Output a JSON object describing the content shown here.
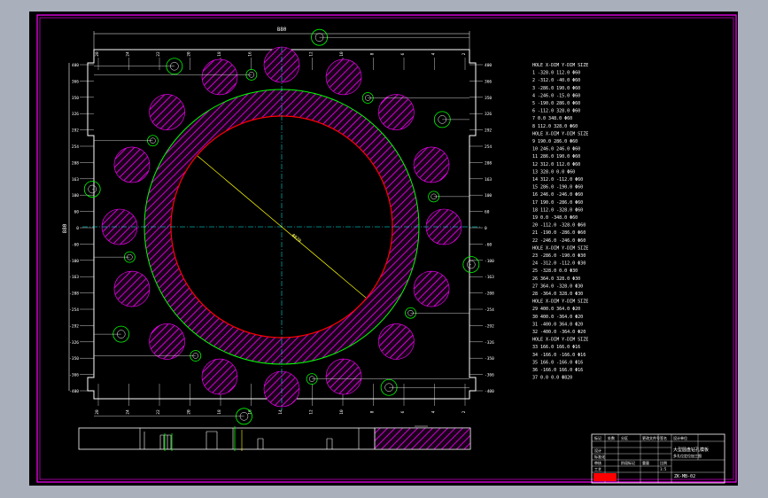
{
  "drawing": {
    "overall_dimension_top": "880",
    "overall_dimension_left": "880",
    "bore_diameter_label": "Φ820",
    "hole_labels_top": [
      "28",
      "24",
      "22",
      "20",
      "18",
      "16",
      "14",
      "12",
      "10",
      "8",
      "6",
      "4",
      "2"
    ],
    "hole_labels_bottom": [
      "28",
      "24",
      "22",
      "20",
      "18",
      "16",
      "14",
      "12",
      "10",
      "8",
      "6",
      "4",
      "2"
    ],
    "dimension_labels_left": [
      "400",
      "366",
      "350",
      "326",
      "292",
      "254",
      "208",
      "163",
      "100",
      "60",
      "0",
      "-60",
      "-100",
      "-163",
      "-208",
      "-254",
      "-292",
      "-326",
      "-350",
      "-366",
      "-400"
    ],
    "dimension_labels_right": [
      "400",
      "366",
      "350",
      "326",
      "292",
      "254",
      "208",
      "163",
      "100",
      "60",
      "0",
      "-60",
      "-100",
      "-163",
      "-208",
      "-254",
      "-292",
      "-326",
      "-350",
      "-366",
      "-400"
    ]
  },
  "hole_table": {
    "rows": [
      "HOLE  X-DIM  Y-DIM  SIZE",
      "1   -328.0   112.0  Φ60",
      "2   -312.0   -40.0  Φ60",
      "3   -286.0   190.0  Φ60",
      "4   -246.0   -15.0  Φ60",
      "5   -190.0   286.0  Φ60",
      "6   -112.0   328.0  Φ60",
      "7      0.0   348.0  Φ60",
      "8    112.0   328.0  Φ60",
      "HOLE  X-DIM  Y-DIM  SIZE",
      "9    190.0   286.0  Φ60",
      "10   246.0   246.0  Φ60",
      "11   286.0   190.0  Φ60",
      "12   312.0   112.0  Φ60",
      "13   328.0     0.0  Φ60",
      "14   312.0  -112.0  Φ60",
      "15   286.0  -190.0  Φ60",
      "16   246.0  -246.0  Φ60",
      "17   190.0  -286.0  Φ60",
      "18   112.0  -328.0  Φ60",
      "19     0.0  -348.0  Φ60",
      "20  -112.0  -328.0  Φ60",
      "21  -190.0  -286.0  Φ60",
      "22  -246.0  -246.0  Φ60",
      "HOLE  X-DIM  Y-DIM  SIZE",
      "23  -286.0  -190.0  Φ30",
      "24  -312.0  -112.0  Φ30",
      "25  -328.0     0.0  Φ30",
      "26   364.0   328.0  Φ30",
      "27   364.0  -328.0  Φ30",
      "28  -364.0   328.0  Φ30",
      "HOLE  X-DIM  Y-DIM  SIZE",
      "29   400.0   364.0  Φ20",
      "30   400.0  -364.0  Φ20",
      "31  -400.0   364.0  Φ20",
      "32  -400.0  -364.0  Φ20",
      "HOLE  X-DIM  Y-DIM  SIZE",
      "33   166.0   166.0  Φ16",
      "34  -166.0  -166.0  Φ16",
      "35   166.0  -166.0  Φ16",
      "36  -166.0   166.0  Φ16",
      "37     0.0     0.0  Φ820"
    ]
  },
  "title_block": {
    "cells": [
      "标记",
      "处数",
      "分区",
      "更改文件号",
      "签名",
      "年月日",
      "设计",
      "标准化",
      "审核",
      "工艺",
      "批准",
      "阶段标记",
      "重量",
      "比例",
      "1:5"
    ],
    "title": "大型圆盘钻孔模板",
    "subtitle": "多孔位定位加工图",
    "drawing_number": "ZK-MB-02",
    "company": "设计单位"
  },
  "colors": {
    "background": "#000000",
    "frame": "#ff00ff",
    "lines": "#ffffff",
    "centerlines": "#00ffff",
    "outer_ring": "#00ff00",
    "bore": "#ff0000",
    "hatch": "#ff00ff",
    "leader": "#ffff00"
  }
}
